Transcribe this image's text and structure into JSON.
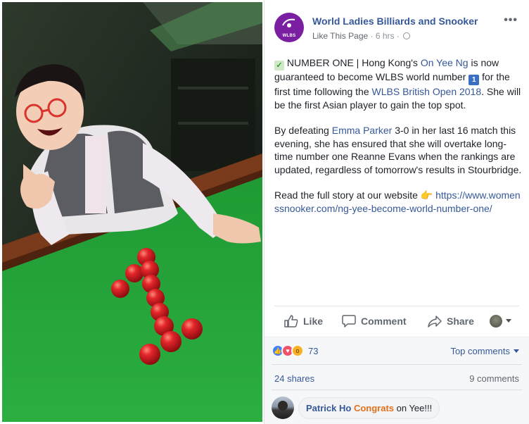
{
  "post": {
    "page_name": "World Ladies Billiards and Snooker",
    "avatar_abbr": "WLBS",
    "like_page": "Like This Page",
    "time_ago": "6 hrs",
    "more_label": "•••",
    "paragraph1": {
      "check_icon": "✓",
      "lead": "NUMBER ONE | Hong Kong's ",
      "link_on_yee": "On Yee Ng",
      "mid": " is now guaranteed to become WLBS world number ",
      "number_badge": "1",
      "mid2": " for the first time following the ",
      "link_open": "WLBS British Open 2018",
      "tail": ". She will be the first Asian player to gain the top spot."
    },
    "paragraph2": {
      "lead": "By defeating ",
      "link_emma": "Emma Parker",
      "tail": " 3-0 in her last 16 match this evening, she has ensured that she will overtake long-time number one Reanne Evans when the rankings are updated, regardless of tomorrow's results in Stourbridge."
    },
    "paragraph3": {
      "lead": "Read the full story at our website ",
      "point_icon": "👉",
      "url": "https://www.womenssnooker.com/ng-yee-become-world-number-one/"
    }
  },
  "actions": {
    "like": "Like",
    "comment": "Comment",
    "share": "Share"
  },
  "feedback": {
    "reaction_count": "73",
    "top_comments": "Top comments",
    "shares": "24 shares",
    "comments": "9 comments"
  },
  "comment": {
    "author": "Patrick Ho",
    "highlight": "Congrats",
    "rest": " on Yee!!!"
  },
  "colors": {
    "link": "#365899",
    "brand_purple": "#7a1fa2",
    "table_green": "#27a83a",
    "ball_red": "#d8151a"
  }
}
